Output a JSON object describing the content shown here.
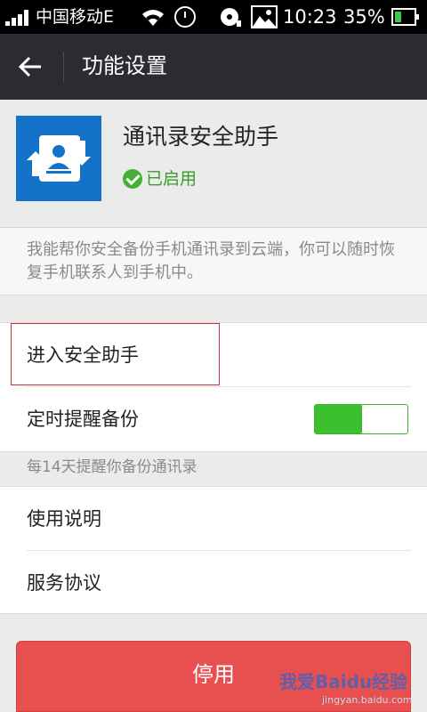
{
  "status_bar": {
    "carrier": "中国移动E",
    "time": "10:23",
    "battery_percent": "35%",
    "battery_level": 0.35,
    "icons": [
      "signal-icon",
      "wifi-icon",
      "alarm-icon",
      "media-disc-icon",
      "image-notification-icon",
      "battery-icon"
    ]
  },
  "header": {
    "title": "功能设置",
    "back_icon": "back-arrow-icon"
  },
  "plugin": {
    "name": "通讯录安全助手",
    "status": "已启用",
    "icon": "contacts-sync-icon",
    "description": "我能帮你安全备份手机通讯录到云端，你可以随时恢复手机联系人到手机中。"
  },
  "settings": {
    "enter_assistant": "进入安全助手",
    "scheduled_backup_reminder": "定时提醒备份",
    "reminder_enabled": true,
    "reminder_hint": "每14天提醒你备份通讯录",
    "instructions": "使用说明",
    "service_agreement": "服务协议"
  },
  "actions": {
    "disable_label": "停用"
  },
  "watermark": {
    "line1": "我爱Baidu经验",
    "line2": "jingyan.baidu.com"
  },
  "colors": {
    "titlebar": "#2a2c31",
    "accent_green": "#3cc02f",
    "danger_red": "#e85050",
    "plugin_icon_blue": "#1473c9",
    "highlight_red": "#c8323a"
  }
}
